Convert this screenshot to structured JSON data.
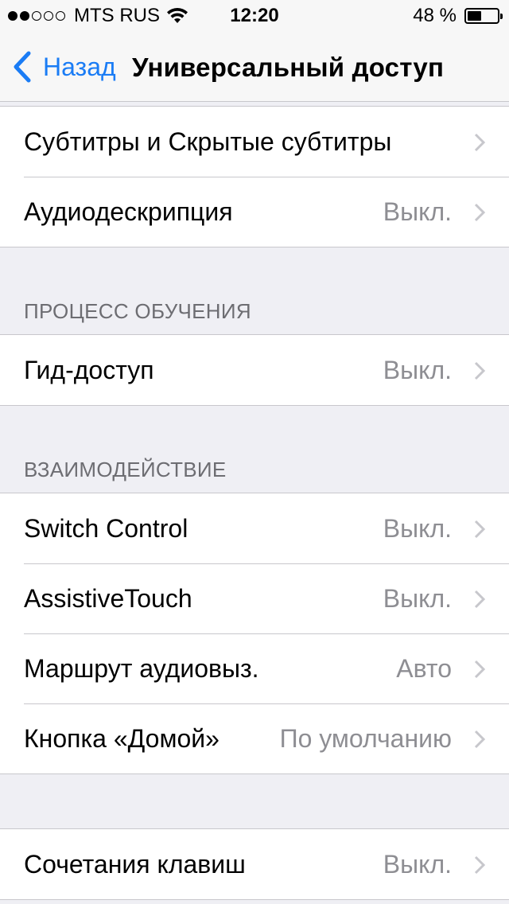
{
  "status_bar": {
    "carrier": "MTS RUS",
    "time": "12:20",
    "battery_percent": "48 %",
    "battery_level": 0.48,
    "signal_bars_filled": 2,
    "signal_bars_total": 5
  },
  "nav": {
    "back_label": "Назад",
    "title": "Универсальный доступ"
  },
  "groups": {
    "media": {
      "rows": [
        {
          "label": "Субтитры и Скрытые субтитры",
          "value": ""
        },
        {
          "label": "Аудиодескрипция",
          "value": "Выкл."
        }
      ]
    },
    "learning": {
      "header": "ПРОЦЕСС ОБУЧЕНИЯ",
      "rows": [
        {
          "label": "Гид-доступ",
          "value": "Выкл."
        }
      ]
    },
    "interaction": {
      "header": "ВЗАИМОДЕЙСТВИЕ",
      "rows": [
        {
          "label": "Switch Control",
          "value": "Выкл."
        },
        {
          "label": "AssistiveTouch",
          "value": "Выкл."
        },
        {
          "label": "Маршрут аудиовыз.",
          "value": "Авто"
        },
        {
          "label": "Кнопка «Домой»",
          "value": "По умолчанию"
        }
      ]
    },
    "shortcuts": {
      "rows": [
        {
          "label": "Сочетания клавиш",
          "value": "Выкл."
        }
      ]
    }
  },
  "colors": {
    "accent": "#1a7cf5",
    "background": "#efeff4",
    "separator": "#c8c7cc",
    "secondary_text": "#8e8e93"
  }
}
